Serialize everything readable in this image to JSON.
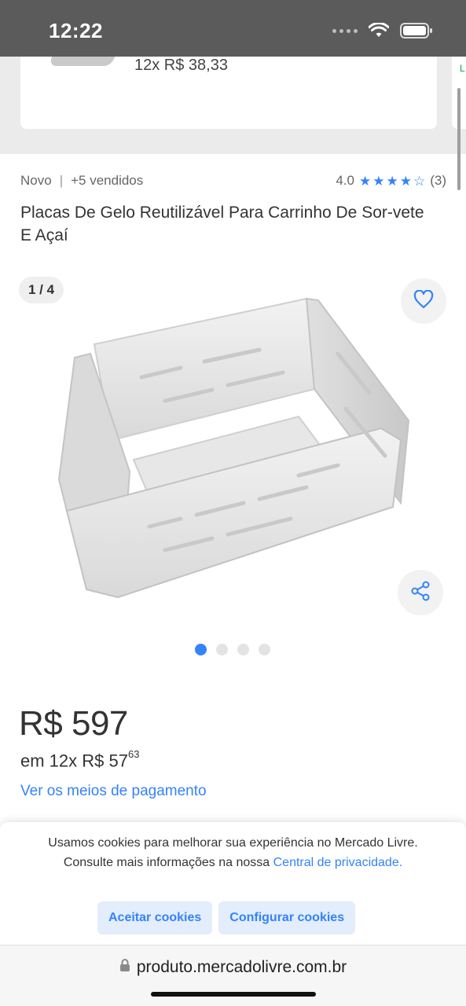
{
  "status_bar": {
    "time": "12:22"
  },
  "previous_card": {
    "installment_price": "12x R$ 38,33"
  },
  "product": {
    "condition": "Novo",
    "separator": "|",
    "sold": "+5 vendidos",
    "rating": "4.0",
    "rating_stars": 4,
    "reviews": "(3)",
    "title": "Placas De Gelo Reutilizável Para Carrinho De Sor-vete E Açaí"
  },
  "gallery": {
    "counter": "1 / 4",
    "total_images": 4,
    "active_index": 0
  },
  "price": {
    "main": "R$ 597",
    "installments_prefix": "em 12x R$ 57",
    "installments_cents": "63",
    "payment_link": "Ver os meios de pagamento"
  },
  "cookies": {
    "text": "Usamos cookies para melhorar sua experiência no Mercado Livre. Consulte mais informações na nossa",
    "link": "Central de privacidade.",
    "accept": "Aceitar cookies",
    "configure": "Configurar cookies"
  },
  "browser": {
    "url": "produto.mercadolivre.com.br"
  },
  "colors": {
    "accent": "#3483fa",
    "status_bar": "#5b5b5b"
  },
  "icons": {
    "favorite": "heart-icon",
    "share": "share-icon",
    "lock": "lock-icon"
  }
}
